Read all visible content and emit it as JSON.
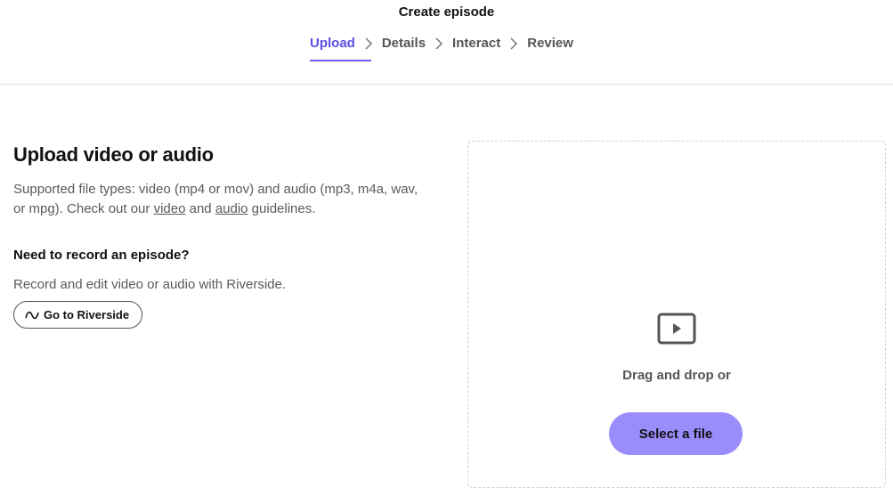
{
  "header": {
    "title": "Create episode",
    "steps": [
      {
        "label": "Upload",
        "active": true
      },
      {
        "label": "Details",
        "active": false
      },
      {
        "label": "Interact",
        "active": false
      },
      {
        "label": "Review",
        "active": false
      }
    ]
  },
  "upload": {
    "heading": "Upload video or audio",
    "desc_prefix": "Supported file types: video (mp4 or mov) and audio (mp3, m4a, wav, or mpg). Check out our ",
    "video_link": "video",
    "desc_and": " and ",
    "audio_link": "audio",
    "desc_suffix": " guidelines."
  },
  "record": {
    "heading": "Need to record an episode?",
    "text": "Record and edit video or audio with Riverside.",
    "button_label": "Go to Riverside",
    "button_icon": "wave-icon"
  },
  "dropzone": {
    "icon": "video-play-icon",
    "text": "Drag and drop or",
    "button_label": "Select a file"
  },
  "colors": {
    "accent": "#5c4ee6",
    "button_bg": "#9a8cfa"
  }
}
